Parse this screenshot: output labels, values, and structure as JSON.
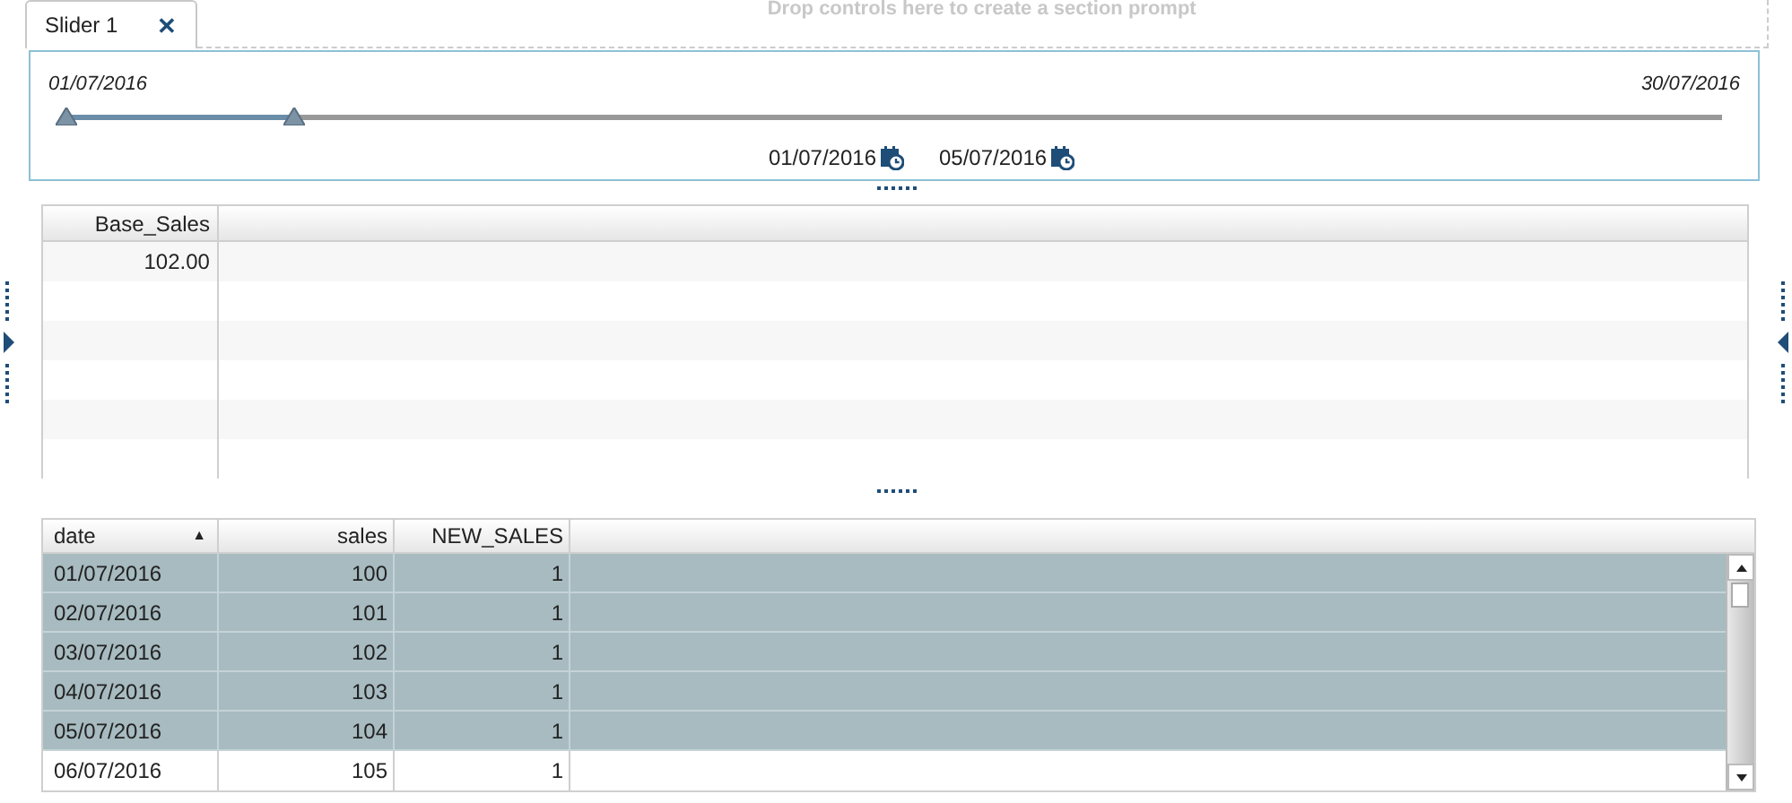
{
  "tab": {
    "label": "Slider 1",
    "close": "✕",
    "selected": true
  },
  "drop_hint": "Drop controls here to create a section prompt",
  "slider": {
    "min_label": "01/07/2016",
    "max_label": "30/07/2016",
    "thumbs": [
      {
        "level": 0,
        "value": "01/07/2016"
      },
      {
        "level": 0.138,
        "value": "05/07/2016"
      }
    ]
  },
  "summary_table": {
    "columns": [
      "Base_Sales"
    ],
    "rows": [
      [
        "102.00"
      ]
    ]
  },
  "detail_table": {
    "columns": [
      {
        "label": "date",
        "sort": "▲"
      },
      {
        "label": "sales"
      },
      {
        "label": "NEW_SALES"
      }
    ],
    "rows": [
      {
        "cells": [
          "01/07/2016",
          "100",
          "1"
        ],
        "selected": true
      },
      {
        "cells": [
          "02/07/2016",
          "101",
          "1"
        ],
        "selected": true
      },
      {
        "cells": [
          "03/07/2016",
          "102",
          "1"
        ],
        "selected": true
      },
      {
        "cells": [
          "04/07/2016",
          "103",
          "1"
        ],
        "selected": true
      },
      {
        "cells": [
          "05/07/2016",
          "104",
          "1"
        ],
        "selected": true
      },
      {
        "cells": [
          "06/07/2016",
          "105",
          "1"
        ],
        "selected": false
      }
    ]
  }
}
